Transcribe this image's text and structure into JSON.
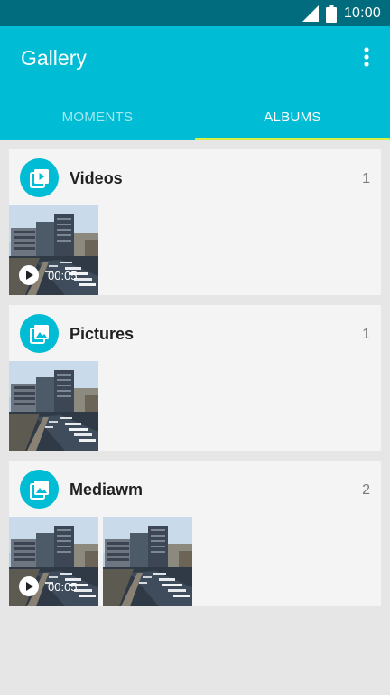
{
  "status_bar": {
    "time": "10:00"
  },
  "app_bar": {
    "title": "Gallery"
  },
  "tabs": [
    {
      "label": "MOMENTS",
      "active": false
    },
    {
      "label": "ALBUMS",
      "active": true
    }
  ],
  "albums": [
    {
      "name": "Videos",
      "count": "1",
      "icon": "video-library-icon",
      "items": [
        {
          "type": "video",
          "duration": "00:05"
        }
      ]
    },
    {
      "name": "Pictures",
      "count": "1",
      "icon": "photo-library-icon",
      "items": [
        {
          "type": "photo"
        }
      ]
    },
    {
      "name": "Mediawm",
      "count": "2",
      "icon": "photo-library-icon",
      "items": [
        {
          "type": "video",
          "duration": "00:05"
        },
        {
          "type": "photo"
        }
      ]
    }
  ],
  "colors": {
    "status_bar": "#006c7e",
    "app_bar": "#00bcd4",
    "tab_indicator": "#d9ef3f",
    "background": "#e6e6e6",
    "card": "#f4f4f4"
  }
}
